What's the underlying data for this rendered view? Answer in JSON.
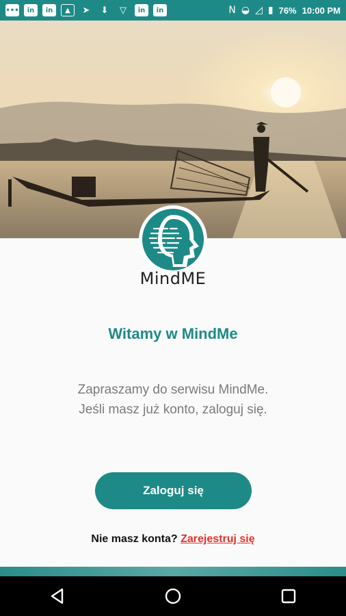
{
  "status_bar": {
    "left_icons": [
      "messages-icon",
      "linkedin-icon",
      "linkedin-icon",
      "image-icon",
      "telegram-icon",
      "download-icon",
      "vpn-icon",
      "linkedin-icon",
      "linkedin-icon"
    ],
    "right_icons": [
      "nfc-icon",
      "wifi-icon",
      "no-signal-icon",
      "battery-icon"
    ],
    "battery": "76%",
    "time": "10:00 PM"
  },
  "logo": {
    "name": "MindME"
  },
  "welcome": {
    "title": "Witamy w MindMe",
    "text": "Zapraszamy do serwisu MindMe. Jeśli masz już konto, zaloguj się."
  },
  "actions": {
    "login_label": "Zaloguj się",
    "no_account_text": "Nie masz konta?",
    "register_label": "Zarejestruj się"
  },
  "navigation": [
    "back-icon",
    "home-icon",
    "recents-icon"
  ],
  "colors": {
    "accent": "#1e8a87",
    "link": "#e4302a",
    "status_bar": "#1e8a87"
  }
}
